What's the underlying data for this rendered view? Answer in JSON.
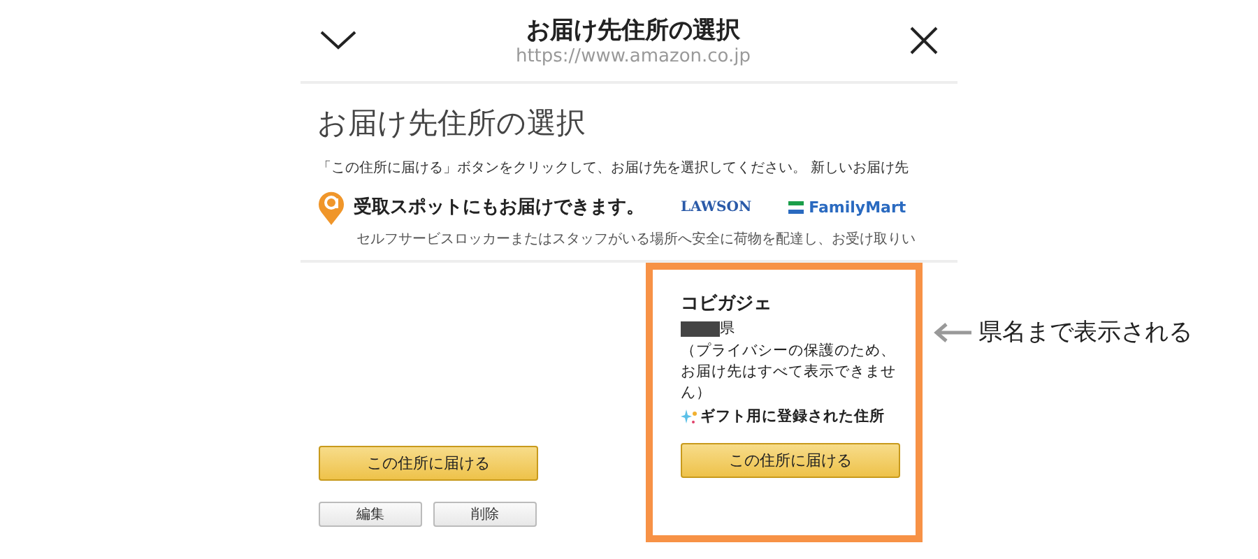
{
  "header": {
    "title": "お届け先住所の選択",
    "url": "https://www.amazon.co.jp"
  },
  "page": {
    "heading": "お届け先住所の選択",
    "instruction": "「この住所に届ける」ボタンをクリックして、お届け先を選択してください。 新しいお届け先",
    "pickup": {
      "title": "受取スポットにもお届けできます。",
      "partners": [
        {
          "name": "LAWSON",
          "kind": "plain"
        },
        {
          "name": "FamilyMart",
          "kind": "stripes"
        }
      ],
      "description": "セルフサービスロッカーまたはスタッフがいる場所へ安全に荷物を配達し、お受け取りい"
    }
  },
  "addresses": [
    {
      "highlighted": false,
      "deliver_button": "この住所に届ける",
      "actions": [
        "編集",
        "削除"
      ]
    },
    {
      "highlighted": true,
      "name": "コビガジェ",
      "prefecture": "県",
      "note": "（プライバシーの保護のため、お届け先はすべて表示できません）",
      "tag": "ギフト用に登録された住所",
      "deliver_button": "この住所に届ける"
    }
  ],
  "annotation": "県名まで表示される"
}
